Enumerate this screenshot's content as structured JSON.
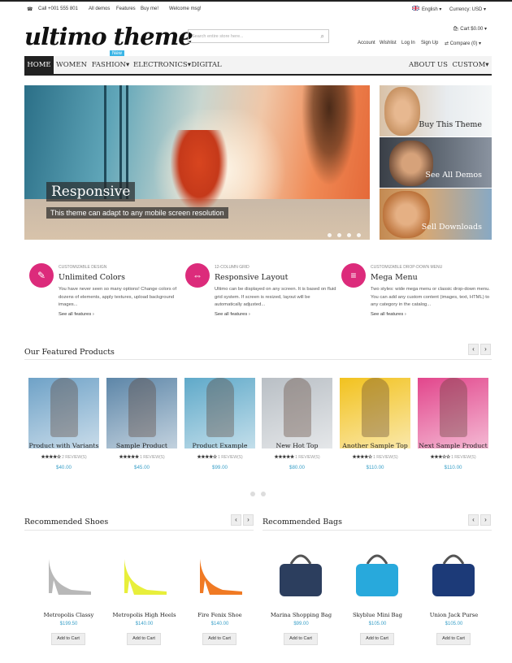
{
  "topbar": {
    "phone": "Call +001 555 801",
    "links": [
      "All demos",
      "Features",
      "Buy me!"
    ],
    "welcome": "Welcome msg!",
    "language": "English",
    "currency": "Currency: USD"
  },
  "header": {
    "logo": "ultimo theme",
    "search_placeholder": "Search entire store here...",
    "cart": "Cart $0.00",
    "account_links": [
      "Account",
      "Wishlist",
      "Log In",
      "Sign Up"
    ],
    "compare": "Compare (0)"
  },
  "nav": {
    "items": [
      "HOME",
      "WOMEN",
      "FASHION",
      "ELECTRONICS",
      "DIGITAL"
    ],
    "right_items": [
      "ABOUT US",
      "CUSTOM"
    ],
    "new_badge": "New"
  },
  "hero": {
    "title": "Responsive",
    "subtitle": "This theme can adapt to any mobile screen resolution"
  },
  "side_banners": [
    "Buy This Theme",
    "See All Demos",
    "Sell Downloads"
  ],
  "features": [
    {
      "small": "CUSTOMIZABLE DESIGN",
      "title": "Unlimited Colors",
      "text": "You have never seen so many options! Change colors of dozens of elements, apply textures, upload background images...",
      "link": "See all features",
      "icon": "paint-brush-icon"
    },
    {
      "small": "12-COLUMN GRID",
      "title": "Responsive Layout",
      "text": "Ultimo can be displayed on any screen. It is based on fluid grid system. If screen is resized, layout will be automatically adjusted...",
      "link": "See all features",
      "icon": "responsive-devices-icon"
    },
    {
      "small": "CUSTOMIZABLE DROP-DOWN MENU",
      "title": "Mega Menu",
      "text": "Two styles: wide mega menu or classic drop-down menu. You can add any custom content (images, text, HTML) to any category in the catalog...",
      "link": "See all features",
      "icon": "menu-icon"
    }
  ],
  "featured": {
    "title": "Our Featured Products",
    "products": [
      {
        "name": "Product with Variants",
        "stars": "★★★★☆",
        "reviews": "2 REVIEW(S)",
        "price": "$40.00",
        "color": "#6fa2c7"
      },
      {
        "name": "Sample Product",
        "stars": "★★★★★",
        "reviews": "1 REVIEW(S)",
        "price": "$45.00",
        "color": "#5d86a8"
      },
      {
        "name": "Product Example",
        "stars": "★★★★☆",
        "reviews": "1 REVIEW(S)",
        "price": "$99.00",
        "color": "#5fa9c9"
      },
      {
        "name": "New Hot Top",
        "stars": "★★★★★",
        "reviews": "1 REVIEW(S)",
        "price": "$80.00",
        "color": "#b9bfc5"
      },
      {
        "name": "Another Sample Top",
        "stars": "★★★★☆",
        "reviews": "1 REVIEW(S)",
        "price": "$110.00",
        "color": "#f2c21e"
      },
      {
        "name": "Next Sample Product",
        "stars": "★★★☆☆",
        "reviews": "1 REVIEW(S)",
        "price": "$110.00",
        "color": "#e2468c"
      }
    ]
  },
  "shoes": {
    "title": "Recommended Shoes",
    "items": [
      {
        "name": "Metropolis Classy",
        "price": "$199.50",
        "button": "Add to Cart",
        "color": "#b8b8b8"
      },
      {
        "name": "Metropolis High Heels",
        "price": "$140.00",
        "button": "Add to Cart",
        "color": "#e8ef3b"
      },
      {
        "name": "Fire Fenix Shoe",
        "price": "$140.00",
        "button": "Add to Cart",
        "color": "#f07a24"
      }
    ]
  },
  "bags": {
    "title": "Recommended Bags",
    "items": [
      {
        "name": "Marina Shopping Bag",
        "price": "$99.00",
        "button": "Add to Cart",
        "color": "#2c3e5e"
      },
      {
        "name": "Skyblue Mini Bag",
        "price": "$105.00",
        "button": "Add to Cart",
        "color": "#28a9dc"
      },
      {
        "name": "Union Jack Purse",
        "price": "$105.00",
        "button": "Add to Cart",
        "color": "#1c3a78"
      }
    ]
  },
  "icons": {
    "cart": "cart-icon",
    "search": "search-icon",
    "phone": "phone-icon",
    "flag": "uk-flag-icon",
    "star": "star-icon",
    "prev": "chevron-left-icon",
    "next": "chevron-right-icon"
  },
  "colors": {
    "accent": "#dc2b7b",
    "price": "#3aa0c8",
    "nav_active": "#222222",
    "badge": "#3ab5e6"
  }
}
